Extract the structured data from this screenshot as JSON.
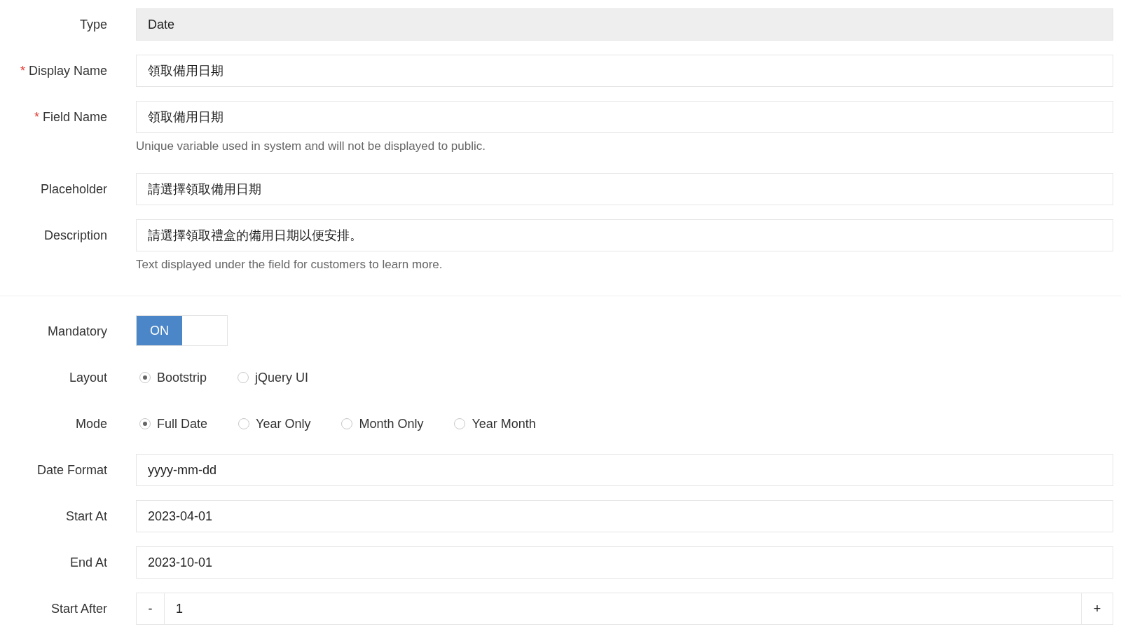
{
  "sections": [
    {
      "rows": [
        {
          "kind": "readonly",
          "label": "Type",
          "value": "Date"
        },
        {
          "kind": "text",
          "label": "Display Name",
          "required_mark": "*",
          "value": "領取備用日期"
        },
        {
          "kind": "text",
          "label": "Field Name",
          "required_mark": "*",
          "value": "領取備用日期",
          "help": "Unique variable used in system and will not be displayed to public."
        },
        {
          "kind": "text",
          "label": "Placeholder",
          "value": "請選擇領取備用日期"
        },
        {
          "kind": "text",
          "label": "Description",
          "value": "請選擇領取禮盒的備用日期以便安排。",
          "help": "Text displayed under the field for customers to learn more."
        }
      ]
    },
    {
      "rows": [
        {
          "kind": "toggle",
          "label": "Mandatory",
          "on": true,
          "on_label": "ON"
        },
        {
          "kind": "radio",
          "label": "Layout",
          "options": [
            {
              "label": "Bootstrip",
              "selected": true
            },
            {
              "label": "jQuery UI",
              "selected": false
            }
          ]
        },
        {
          "kind": "radio",
          "label": "Mode",
          "options": [
            {
              "label": "Full Date",
              "selected": true
            },
            {
              "label": "Year Only",
              "selected": false
            },
            {
              "label": "Month Only",
              "selected": false
            },
            {
              "label": "Year Month",
              "selected": false
            }
          ]
        },
        {
          "kind": "text",
          "label": "Date Format",
          "value": "yyyy-mm-dd"
        },
        {
          "kind": "text",
          "label": "Start At",
          "value": "2023-04-01"
        },
        {
          "kind": "text",
          "label": "End At",
          "value": "2023-10-01"
        },
        {
          "kind": "stepper",
          "label": "Start After",
          "value": "1",
          "minus": "-",
          "plus": "+"
        }
      ]
    }
  ]
}
